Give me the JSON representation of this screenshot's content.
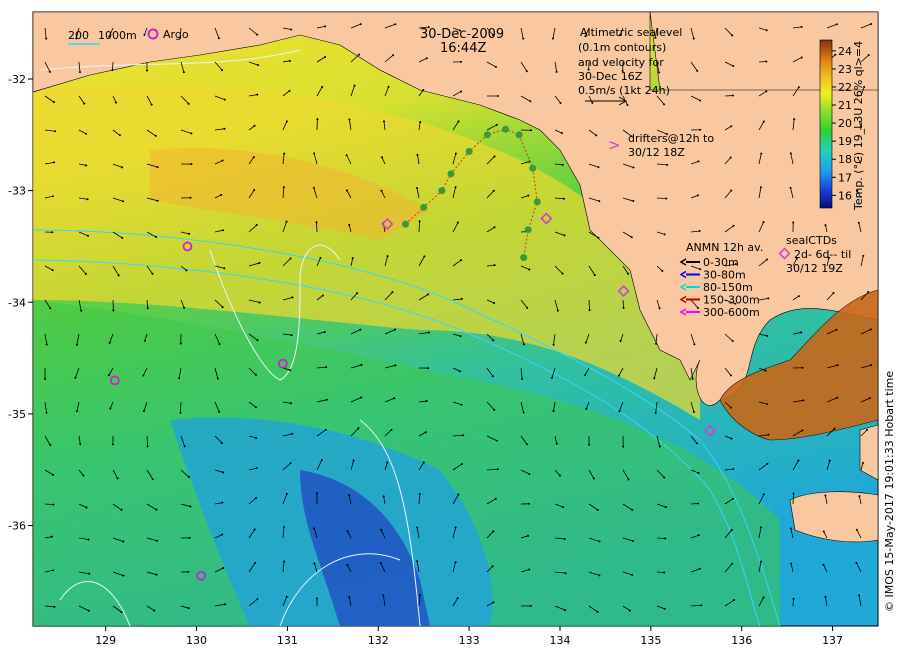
{
  "title": {
    "date": "30-Dec-2009",
    "time": "16:44Z"
  },
  "axes": {
    "x_ticks": [
      "129",
      "130",
      "131",
      "132",
      "133",
      "134",
      "135",
      "136",
      "137"
    ],
    "y_ticks": [
      "-32",
      "-33",
      "-34",
      "-35",
      "-36"
    ],
    "xlim": [
      128.2,
      137.5
    ],
    "ylim": [
      -36.9,
      -31.4
    ]
  },
  "contour_legend": {
    "label_200": "200",
    "label_1000": "1000m",
    "argo_label": "Argo"
  },
  "sealevel_note": {
    "line1": "Altimetric sealevel",
    "line2": "(0.1m contours)",
    "line3": "and velocity for",
    "line4": "30-Dec 16Z",
    "line5": "0.5m/s (1kt 24h)"
  },
  "drifters_note": {
    "symbol": ">",
    "line1": "drifters@12h to",
    "line2": "30/12 18Z"
  },
  "anmn_legend": {
    "title": "ANMN 12h av.",
    "items": [
      {
        "label": "0-30m",
        "color": "#000000"
      },
      {
        "label": "30-80m",
        "color": "#0000ff"
      },
      {
        "label": "80-150m",
        "color": "#00d8e0"
      },
      {
        "label": "150-300m",
        "color": "#c00000"
      },
      {
        "label": "300-600m",
        "color": "#ff00ff"
      }
    ]
  },
  "seal_legend": {
    "title": "sealCTDs",
    "line1": "2d- 6d-- til",
    "line2": "30/12 19Z"
  },
  "colorbar": {
    "label": "Temp. (°C) 19_L3U 26% ql>=4",
    "ticks": [
      "16",
      "17",
      "18",
      "19",
      "20",
      "21",
      "22",
      "23",
      "24"
    ],
    "range": [
      15.3,
      24.6
    ]
  },
  "credit": "© IMOS 15-May-2017 19:01:33 Hobart time",
  "colors": {
    "land": "#f9c8a0",
    "contour": "#e8f4ff",
    "argo": "#d020d0",
    "drifter": "#3a9a3a",
    "seal": "#d040d0"
  },
  "argo_floats": [
    {
      "lon": 129.9,
      "lat": -33.5
    },
    {
      "lon": 129.1,
      "lat": -34.7
    },
    {
      "lon": 130.95,
      "lat": -34.55
    },
    {
      "lon": 130.05,
      "lat": -36.45
    }
  ],
  "drifter_track": [
    {
      "lon": 132.3,
      "lat": -33.3
    },
    {
      "lon": 132.5,
      "lat": -33.15
    },
    {
      "lon": 132.7,
      "lat": -33.0
    },
    {
      "lon": 132.8,
      "lat": -32.85
    },
    {
      "lon": 133.0,
      "lat": -32.65
    },
    {
      "lon": 133.2,
      "lat": -32.5
    },
    {
      "lon": 133.4,
      "lat": -32.45
    },
    {
      "lon": 133.55,
      "lat": -32.5
    },
    {
      "lon": 133.7,
      "lat": -32.8
    },
    {
      "lon": 133.75,
      "lat": -33.1
    },
    {
      "lon": 133.65,
      "lat": -33.35
    },
    {
      "lon": 133.6,
      "lat": -33.6
    }
  ],
  "seal_positions": [
    {
      "lon": 132.1,
      "lat": -33.3
    },
    {
      "lon": 133.85,
      "lat": -33.25
    },
    {
      "lon": 134.7,
      "lat": -33.9
    },
    {
      "lon": 135.65,
      "lat": -35.15
    }
  ]
}
